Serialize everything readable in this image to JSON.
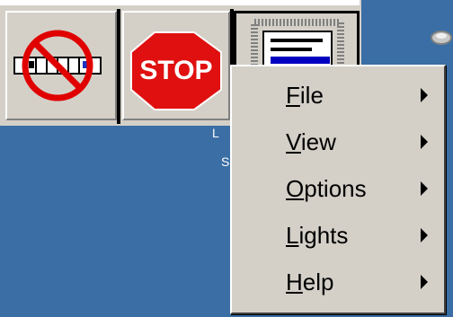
{
  "toolbar": {
    "buttons": [
      {
        "name": "no-strip-button",
        "icon": "no-entry-strip-icon"
      },
      {
        "name": "stop-button",
        "icon": "stop-sign-icon",
        "label": "STOP"
      },
      {
        "name": "menu-button",
        "icon": "window-menu-icon"
      }
    ]
  },
  "menu": {
    "items": [
      {
        "label": "File"
      },
      {
        "label": "View"
      },
      {
        "label": "Options"
      },
      {
        "label": "Lights"
      },
      {
        "label": "Help"
      }
    ]
  },
  "colors": {
    "desktop": "#3a6ea5",
    "face": "#d4d0c8",
    "stop_red": "#e01010",
    "no_sign_red": "#e00000"
  }
}
